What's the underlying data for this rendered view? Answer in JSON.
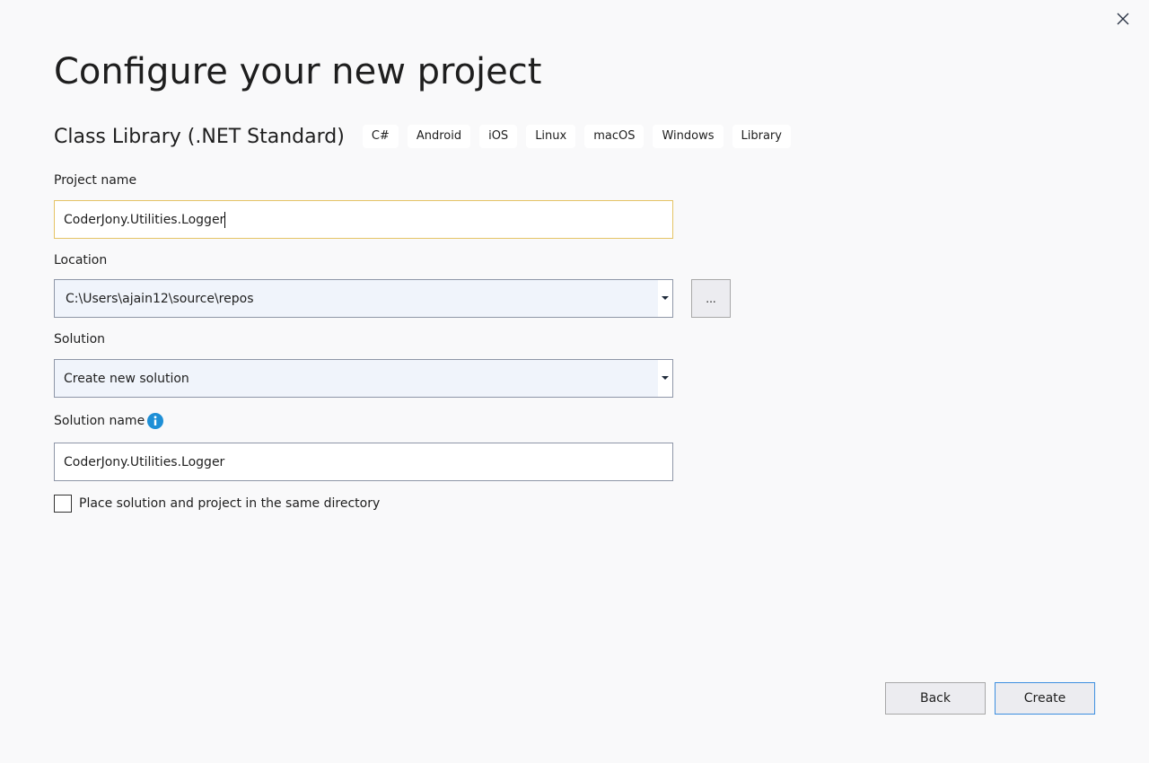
{
  "window": {
    "close_icon": "close-icon"
  },
  "header": {
    "title": "Configure your new project"
  },
  "template": {
    "name": "Class Library (.NET Standard)",
    "tags": [
      "C#",
      "Android",
      "iOS",
      "Linux",
      "macOS",
      "Windows",
      "Library"
    ]
  },
  "form": {
    "project_name": {
      "label": "Project name",
      "value": "CoderJony.Utilities.Logger"
    },
    "location": {
      "label": "Location",
      "value": "C:\\Users\\ajain12\\source\\repos",
      "browse_label": "..."
    },
    "solution": {
      "label": "Solution",
      "value": "Create new solution"
    },
    "solution_name": {
      "label": "Solution name",
      "value": "CoderJony.Utilities.Logger",
      "info_icon": "info-icon"
    },
    "same_directory": {
      "label": "Place solution and project in the same directory",
      "checked": false
    }
  },
  "footer": {
    "back_label": "Back",
    "create_label": "Create"
  },
  "colors": {
    "focus_border": "#e5c365",
    "primary_border": "#3d8fe0",
    "info_icon": "#1e8fd6",
    "background": "#f9f9fa"
  }
}
